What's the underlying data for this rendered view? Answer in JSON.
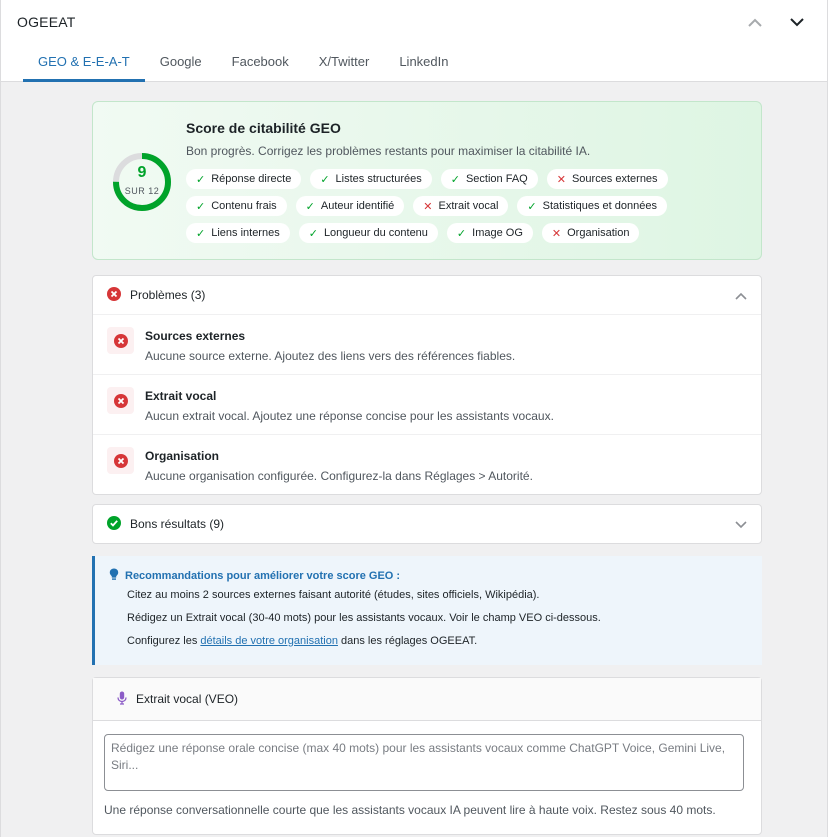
{
  "panel": {
    "title": "OGEEAT"
  },
  "tabs": [
    {
      "label": "GEO & E-E-A-T",
      "active": true
    },
    {
      "label": "Google"
    },
    {
      "label": "Facebook"
    },
    {
      "label": "X/Twitter"
    },
    {
      "label": "LinkedIn"
    }
  ],
  "score": {
    "value": "9",
    "max_label": "SUR 12",
    "fraction": 0.75,
    "title": "Score de citabilité GEO",
    "subtitle": "Bon progrès. Corrigez les problèmes restants pour maximiser la citabilité IA.",
    "checks": [
      {
        "label": "Réponse directe",
        "ok": true
      },
      {
        "label": "Listes structurées",
        "ok": true
      },
      {
        "label": "Section FAQ",
        "ok": true
      },
      {
        "label": "Sources externes",
        "ok": false
      },
      {
        "label": "Contenu frais",
        "ok": true
      },
      {
        "label": "Auteur identifié",
        "ok": true
      },
      {
        "label": "Extrait vocal",
        "ok": false
      },
      {
        "label": "Statistiques et données",
        "ok": true
      },
      {
        "label": "Liens internes",
        "ok": true
      },
      {
        "label": "Longueur du contenu",
        "ok": true
      },
      {
        "label": "Image OG",
        "ok": true
      },
      {
        "label": "Organisation",
        "ok": false
      }
    ],
    "ok_mark": "✓",
    "ko_mark": "✕"
  },
  "problems": {
    "header": "Problèmes (3)",
    "items": [
      {
        "title": "Sources externes",
        "desc": "Aucune source externe. Ajoutez des liens vers des références fiables."
      },
      {
        "title": "Extrait vocal",
        "desc": "Aucun extrait vocal. Ajoutez une réponse concise pour les assistants vocaux."
      },
      {
        "title": "Organisation",
        "desc": "Aucune organisation configurée. Configurez-la dans Réglages > Autorité."
      }
    ]
  },
  "good": {
    "header": "Bons résultats (9)"
  },
  "reco": {
    "title": "Recommandations pour améliorer votre score GEO :",
    "line1": "Citez au moins 2 sources externes faisant autorité (études, sites officiels, Wikipédia).",
    "line2": "Rédigez un Extrait vocal (30-40 mots) pour les assistants vocaux. Voir le champ VEO ci-dessous.",
    "line3_pre": "Configurez les ",
    "line3_link": "détails de votre organisation",
    "line3_post": " dans les réglages OGEEAT."
  },
  "veo": {
    "header": "Extrait vocal (VEO)",
    "placeholder": "Rédigez une réponse orale concise (max 40 mots) pour les assistants vocaux comme ChatGPT Voice, Gemini Live, Siri...",
    "value": "",
    "help": "Une réponse conversationnelle courte que les assistants vocaux IA peuvent lire à haute voix. Restez sous 40 mots."
  },
  "colors": {
    "accent": "#2271b1",
    "success": "#00a32a",
    "error": "#d63638"
  }
}
